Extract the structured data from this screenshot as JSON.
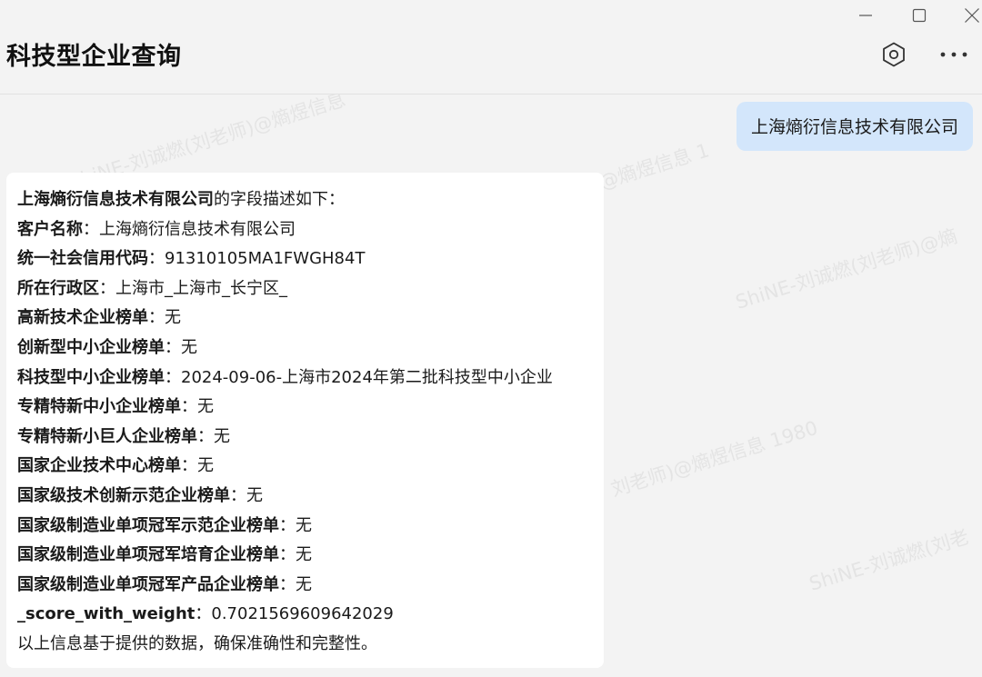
{
  "window": {
    "app_title": "科技型企业查询",
    "controls": [
      "minimize",
      "maximize",
      "close"
    ],
    "header_icons": [
      "settings-hex-icon",
      "more-icon"
    ]
  },
  "watermark": {
    "texts": [
      "ShiNE-刘诚燃(刘老师)@熵煜信息",
      "@熵煜信息 1",
      "ShiNE-刘诚燃(刘老师)@熵",
      "刘老师)@熵煜信息 1980",
      "ShiNE-刘诚燃(刘老"
    ]
  },
  "chat": {
    "user_message": "上海熵衍信息技术有限公司",
    "reply": {
      "intro_company": "上海熵衍信息技术有限公司",
      "intro_suffix": "的字段描述如下：",
      "fields": [
        {
          "key": "客户名称",
          "sep": "：",
          "value": "上海熵衍信息技术有限公司"
        },
        {
          "key": "统一社会信用代码",
          "sep": "：",
          "value": "91310105MA1FWGH84T"
        },
        {
          "key": "所在行政区",
          "sep": "：",
          "value": "上海市_上海市_长宁区_"
        },
        {
          "key": "高新技术企业榜单",
          "sep": "：",
          "value": "无"
        },
        {
          "key": "创新型中小企业榜单",
          "sep": "：",
          "value": "无"
        },
        {
          "key": "科技型中小企业榜单",
          "sep": "：",
          "value": "2024-09-06-上海市2024年第二批科技型中小企业"
        },
        {
          "key": "专精特新中小企业榜单",
          "sep": "：",
          "value": "无"
        },
        {
          "key": "专精特新小巨人企业榜单",
          "sep": "：",
          "value": "无"
        },
        {
          "key": "国家企业技术中心榜单",
          "sep": "：",
          "value": "无"
        },
        {
          "key": "国家级技术创新示范企业榜单",
          "sep": "：",
          "value": "无"
        },
        {
          "key": "国家级制造业单项冠军示范企业榜单",
          "sep": "：",
          "value": "无"
        },
        {
          "key": "国家级制造业单项冠军培育企业榜单",
          "sep": "：",
          "value": "无"
        },
        {
          "key": "国家级制造业单项冠军产品企业榜单",
          "sep": "：",
          "value": "无"
        },
        {
          "key": "_score_with_weight",
          "sep": "：",
          "value": "0.7021569609642029"
        }
      ],
      "footer": "以上信息基于提供的数据，确保准确性和完整性。"
    }
  }
}
